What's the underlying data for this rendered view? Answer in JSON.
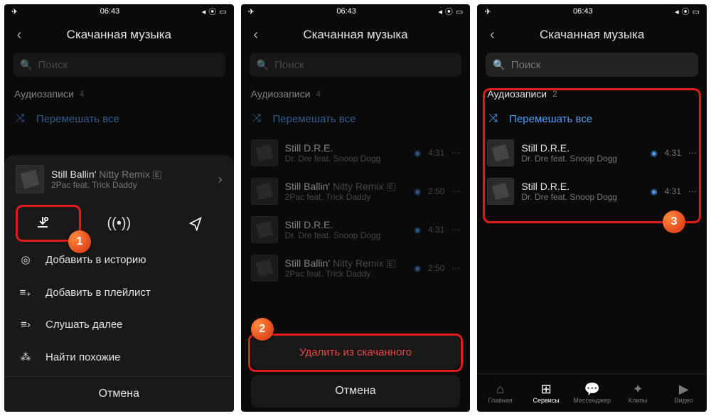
{
  "status": {
    "time": "06:43",
    "plane": "✈",
    "signal": "◂",
    "battery": "▢"
  },
  "header": {
    "title": "Скачанная музыка"
  },
  "search": {
    "placeholder": "Поиск"
  },
  "section": {
    "label": "Аудиозаписи",
    "count_4": "4",
    "count_2": "2"
  },
  "shuffle": "Перемешать все",
  "cancel": "Отмена",
  "delete": "Удалить из скачанного",
  "panel1": {
    "now": {
      "title": "Still Ballin'",
      "suffix": "Nitty Remix",
      "artist": "2Pac feat. Trick Daddy"
    },
    "menu": {
      "story": "Добавить в историю",
      "playlist": "Добавить в плейлист",
      "next": "Слушать далее",
      "similar": "Найти похожие"
    }
  },
  "tracks4": [
    {
      "title": "Still D.R.E.",
      "suffix": "",
      "artist": "Dr. Dre feat. Snoop Dogg",
      "dur": "4:31"
    },
    {
      "title": "Still Ballin'",
      "suffix": "Nitty Remix",
      "artist": "2Pac feat. Trick Daddy",
      "dur": "2:50"
    },
    {
      "title": "Still D.R.E.",
      "suffix": "",
      "artist": "Dr. Dre feat. Snoop Dogg",
      "dur": "4:31"
    },
    {
      "title": "Still Ballin'",
      "suffix": "Nitty Remix",
      "artist": "2Pac feat. Trick Daddy",
      "dur": "2:50"
    }
  ],
  "tracks2": [
    {
      "title": "Still D.R.E.",
      "artist": "Dr. Dre feat. Snoop Dogg",
      "dur": "4:31"
    },
    {
      "title": "Still D.R.E.",
      "artist": "Dr. Dre feat. Snoop Dogg",
      "dur": "4:31"
    }
  ],
  "nav": {
    "home": "Главная",
    "services": "Сервисы",
    "messenger": "Мессенджер",
    "clips": "Клипы",
    "video": "Видео"
  },
  "badges": {
    "b1": "1",
    "b2": "2",
    "b3": "3"
  }
}
